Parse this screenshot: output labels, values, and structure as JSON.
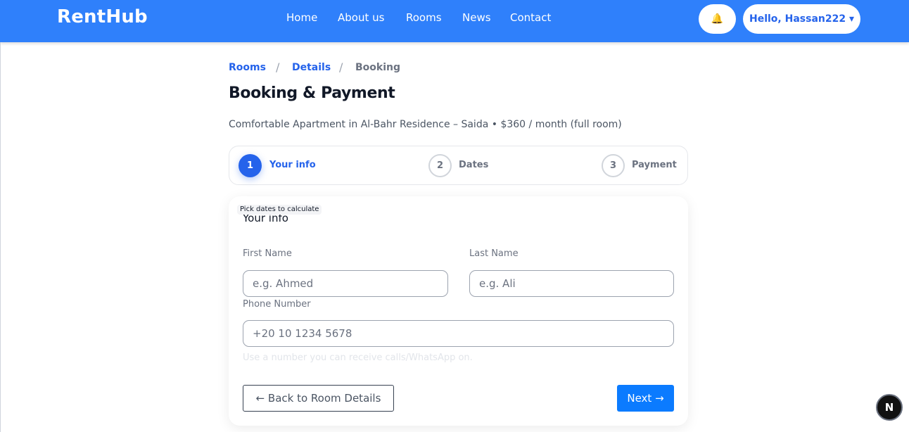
{
  "header": {
    "brand": "RentHub",
    "nav": [
      "Home",
      "About us",
      "Rooms",
      "News",
      "Contact"
    ],
    "bell_icon": "bell-icon",
    "user_menu": "Hello, Hassan222 ▾"
  },
  "breadcrumb": {
    "items": [
      "Rooms",
      "Details",
      "Booking"
    ],
    "separator": "/"
  },
  "page": {
    "title": "Booking & Payment",
    "subtitle": "Comfortable Apartment in Al-Bahr Residence – Saida • $360 / month (full room)"
  },
  "stepper": {
    "steps": [
      {
        "number": "1",
        "label": "Your info",
        "state": "active"
      },
      {
        "number": "2",
        "label": "Dates",
        "state": "idle"
      },
      {
        "number": "3",
        "label": "Payment",
        "state": "idle"
      }
    ]
  },
  "form": {
    "tooltip": "Pick dates to calculate",
    "section_title": "Your info",
    "first_name": {
      "label": "First Name",
      "placeholder": "e.g. Ahmed",
      "value": ""
    },
    "last_name": {
      "label": "Last Name",
      "placeholder": "e.g. Ali",
      "value": ""
    },
    "phone": {
      "label": "Phone Number",
      "placeholder": "+20 10 1234 5678",
      "value": ""
    },
    "phone_hint": "Use a number you can receive calls/WhatsApp on.",
    "back_button": "← Back to Room Details",
    "next_button": "Next →"
  },
  "dev_badge": "N",
  "colors": {
    "primary": "#2f80fb",
    "accent": "#2563eb",
    "button": "#0b7bff"
  }
}
